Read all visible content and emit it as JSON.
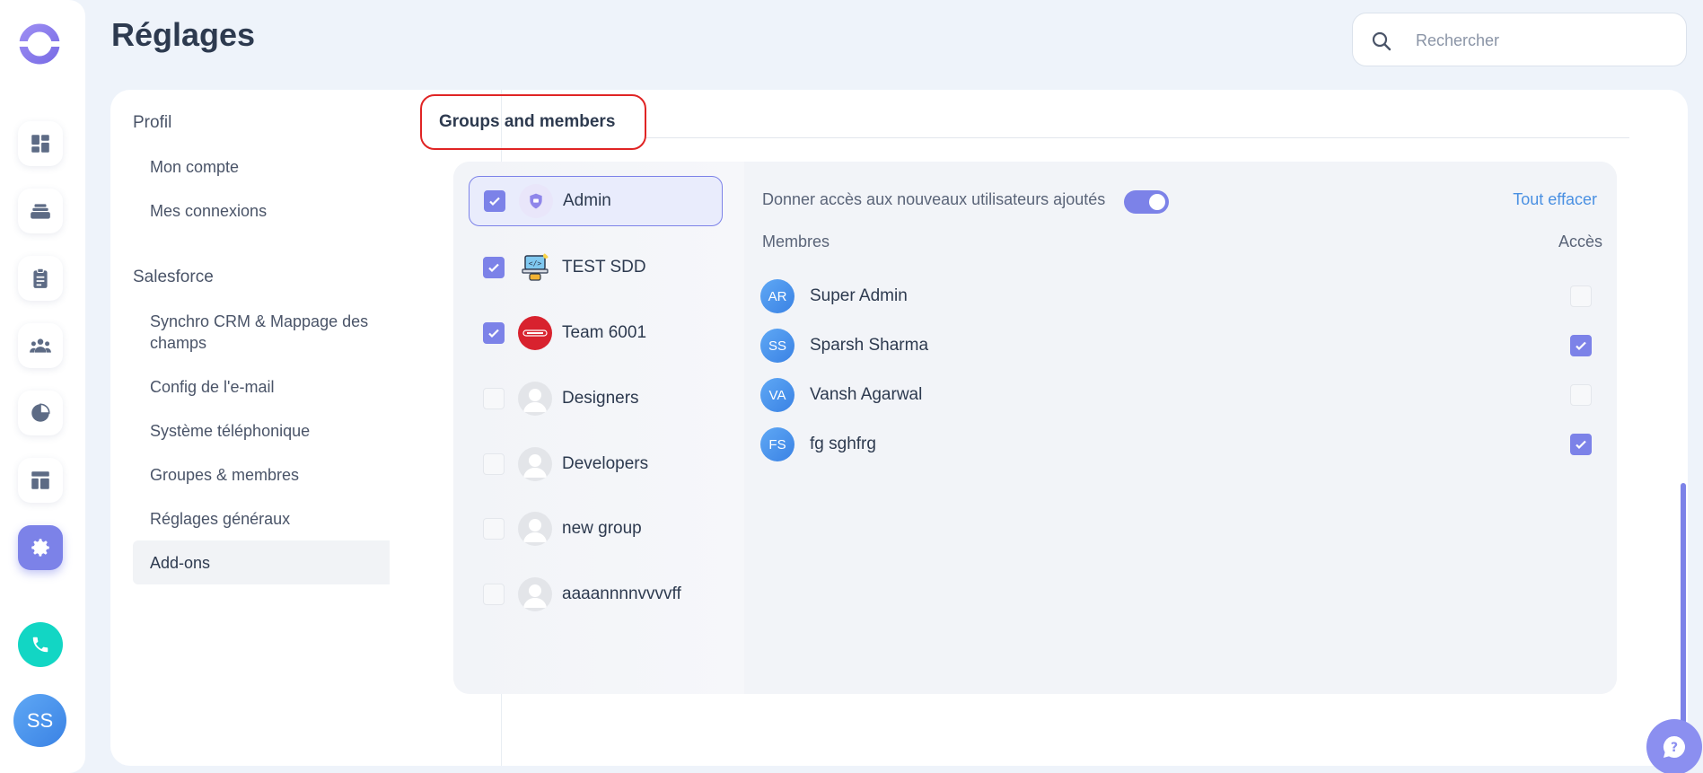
{
  "app": {
    "title": "Réglages"
  },
  "search": {
    "placeholder": "Rechercher"
  },
  "sidebar": {
    "user_initials": "SS",
    "icons": [
      "dashboard-icon",
      "layers-icon",
      "clipboard-icon",
      "team-icon",
      "pie-chart-icon",
      "layout-icon",
      "gear-icon",
      "phone-icon"
    ]
  },
  "settings_nav": {
    "sections": [
      {
        "label": "Profil",
        "items": [
          "Mon compte",
          "Mes connexions"
        ]
      },
      {
        "label": "Salesforce",
        "items": [
          "Synchro CRM & Mappage des champs",
          "Config de l'e-mail",
          "Système téléphonique",
          "Groupes & membres",
          "Réglages généraux",
          "Add-ons"
        ]
      }
    ],
    "active_item": "Add-ons"
  },
  "tab": {
    "label": "Groups and members"
  },
  "groups": [
    {
      "name": "Admin",
      "checked": true,
      "selected": true,
      "icon": "shield-icon"
    },
    {
      "name": "TEST SDD",
      "checked": true,
      "selected": false,
      "icon": "robot-laptop-icon"
    },
    {
      "name": "Team 6001",
      "checked": true,
      "selected": false,
      "icon": "team-logo-icon"
    },
    {
      "name": "Designers",
      "checked": false,
      "selected": false,
      "icon": "user-placeholder-icon"
    },
    {
      "name": "Developers",
      "checked": false,
      "selected": false,
      "icon": "user-placeholder-icon"
    },
    {
      "name": "new group",
      "checked": false,
      "selected": false,
      "icon": "user-placeholder-icon"
    },
    {
      "name": "aaaannnnvvvvff",
      "checked": false,
      "selected": false,
      "icon": "user-placeholder-icon"
    }
  ],
  "members_panel": {
    "access_toggle_label": "Donner accès aux nouveaux utilisateurs ajoutés",
    "access_toggle_on": true,
    "clear_all": "Tout effacer",
    "col_members": "Membres",
    "col_access": "Accès",
    "members": [
      {
        "initials": "AR",
        "name": "Super Admin",
        "access": false
      },
      {
        "initials": "SS",
        "name": "Sparsh Sharma",
        "access": true
      },
      {
        "initials": "VA",
        "name": "Vansh Agarwal",
        "access": false
      },
      {
        "initials": "FS",
        "name": "fg sghfrg",
        "access": true
      }
    ]
  },
  "colors": {
    "accent": "#7c82e8",
    "link": "#4a90e2",
    "highlight": "#e02424",
    "phone": "#12d6c4"
  }
}
